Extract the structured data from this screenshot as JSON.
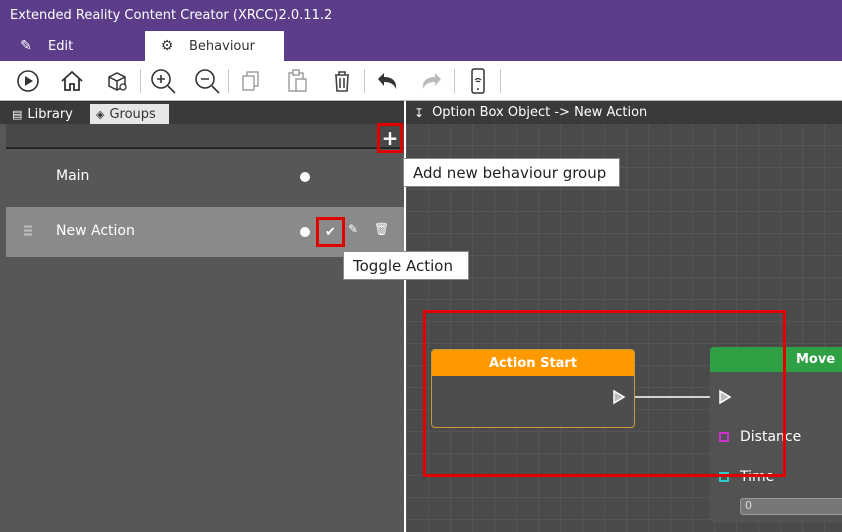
{
  "window": {
    "title": "Extended Reality Content Creator (XRCC)2.0.11.2"
  },
  "menu": {
    "edit_label": "Edit",
    "behaviour_label": "Behaviour"
  },
  "left_panel": {
    "tabs": {
      "library": "Library",
      "groups": "Groups"
    },
    "add_group_symbol": "+",
    "groups": [
      {
        "label": "Main"
      },
      {
        "label": "New Action"
      }
    ]
  },
  "tooltips": {
    "add_group": "Add new behaviour group",
    "toggle_action": "Toggle Action"
  },
  "canvas": {
    "breadcrumb": "Option Box Object -> New Action",
    "action_start": {
      "title": "Action Start"
    },
    "move": {
      "title": "Move",
      "ports": [
        {
          "label": "Distance",
          "color": "#cc33cc"
        },
        {
          "label": "Time",
          "color": "#33cccc"
        }
      ],
      "time_value": "0"
    }
  },
  "colors": {
    "titlebar": "#5c3d8a",
    "highlight": "#e00000",
    "action_start": "#ff9900",
    "move": "#2fa043"
  }
}
